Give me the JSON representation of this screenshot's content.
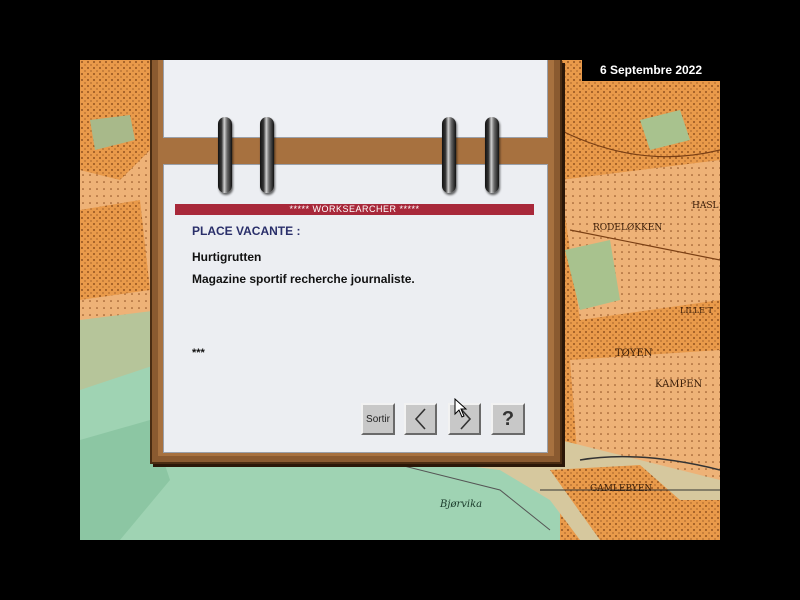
{
  "date": "6 Septembre 2022",
  "header_bar": "***** WORKSEARCHER *****",
  "title": "PLACE VACANTE :",
  "company": "Hurtigrutten",
  "description": "Magazine sportif recherche journaliste.",
  "footer_marker": "***",
  "buttons": {
    "exit": "Sortir",
    "prev_icon": "chevron-left-icon",
    "next_icon": "chevron-right-icon",
    "help": "?"
  },
  "map_labels": {
    "rodelokken": "RODELØKKEN",
    "toyen": "TØYEN",
    "kampen": "KAMPEN",
    "gamlebyen": "GAMLEBYEN",
    "bjorvika": "Bjørvika",
    "hasle": "HASL",
    "lille_t": "LILLE T"
  },
  "colors": {
    "header_bar": "#a8283a",
    "title_text": "#2a2f6a",
    "page": "#eceef2",
    "board": "#a7713f"
  }
}
